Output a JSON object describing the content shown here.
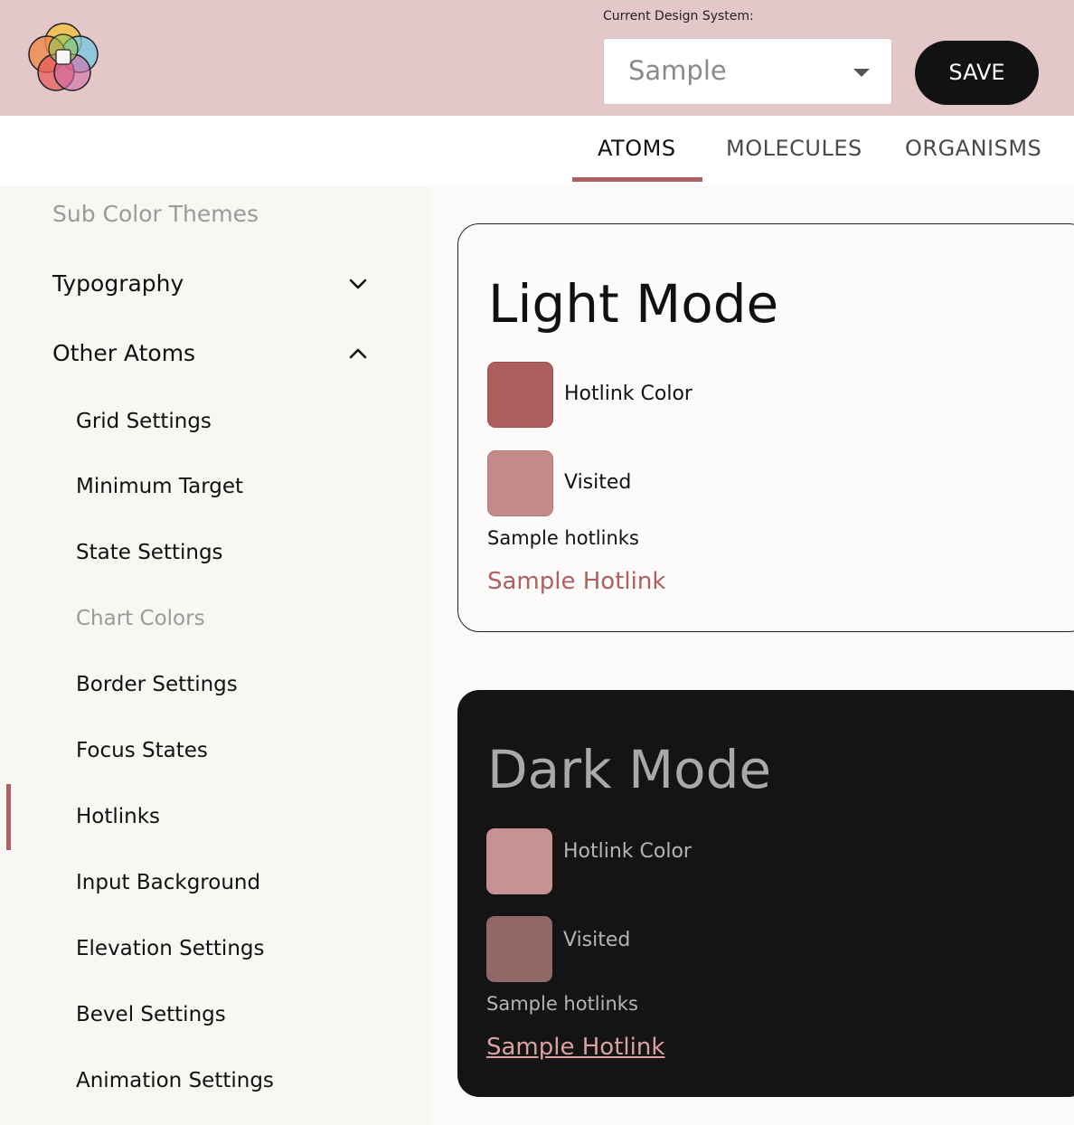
{
  "header": {
    "logo_icon": "overlapping-circles-logo-icon",
    "design_system_label": "Current Design System:",
    "design_system_value": "Sample",
    "save_label": "SAVE"
  },
  "tabs": [
    {
      "label": "ATOMS",
      "active": true
    },
    {
      "label": "MOLECULES",
      "active": false
    },
    {
      "label": "ORGANISMS",
      "active": false
    }
  ],
  "sidebar": {
    "sub_color_themes": "Sub Color Themes",
    "typography": "Typography",
    "other_atoms": "Other Atoms",
    "items": [
      {
        "label": "Grid Settings"
      },
      {
        "label": "Minimum Target"
      },
      {
        "label": "State Settings"
      },
      {
        "label": "Chart Colors"
      },
      {
        "label": "Border Settings"
      },
      {
        "label": "Focus States"
      },
      {
        "label": "Hotlinks"
      },
      {
        "label": "Input Background"
      },
      {
        "label": "Elevation Settings"
      },
      {
        "label": "Bevel Settings"
      },
      {
        "label": "Animation Settings"
      }
    ],
    "active_item": "Hotlinks"
  },
  "light_mode": {
    "title": "Light Mode",
    "hotlink_color_label": "Hotlink Color",
    "hotlink_color": "#ad5f60",
    "visited_label": "Visited",
    "visited_color": "#c48a89",
    "sample_label": "Sample hotlinks",
    "sample_link": "Sample Hotlink"
  },
  "dark_mode": {
    "title": "Dark Mode",
    "hotlink_color_label": "Hotlink Color",
    "hotlink_color": "#c89292",
    "visited_label": "Visited",
    "visited_color": "#916868",
    "sample_label": "Sample hotlinks",
    "sample_link": "Sample Hotlink"
  },
  "colors": {
    "header_bg": "#e4c8c9",
    "accent": "#b05e60"
  }
}
